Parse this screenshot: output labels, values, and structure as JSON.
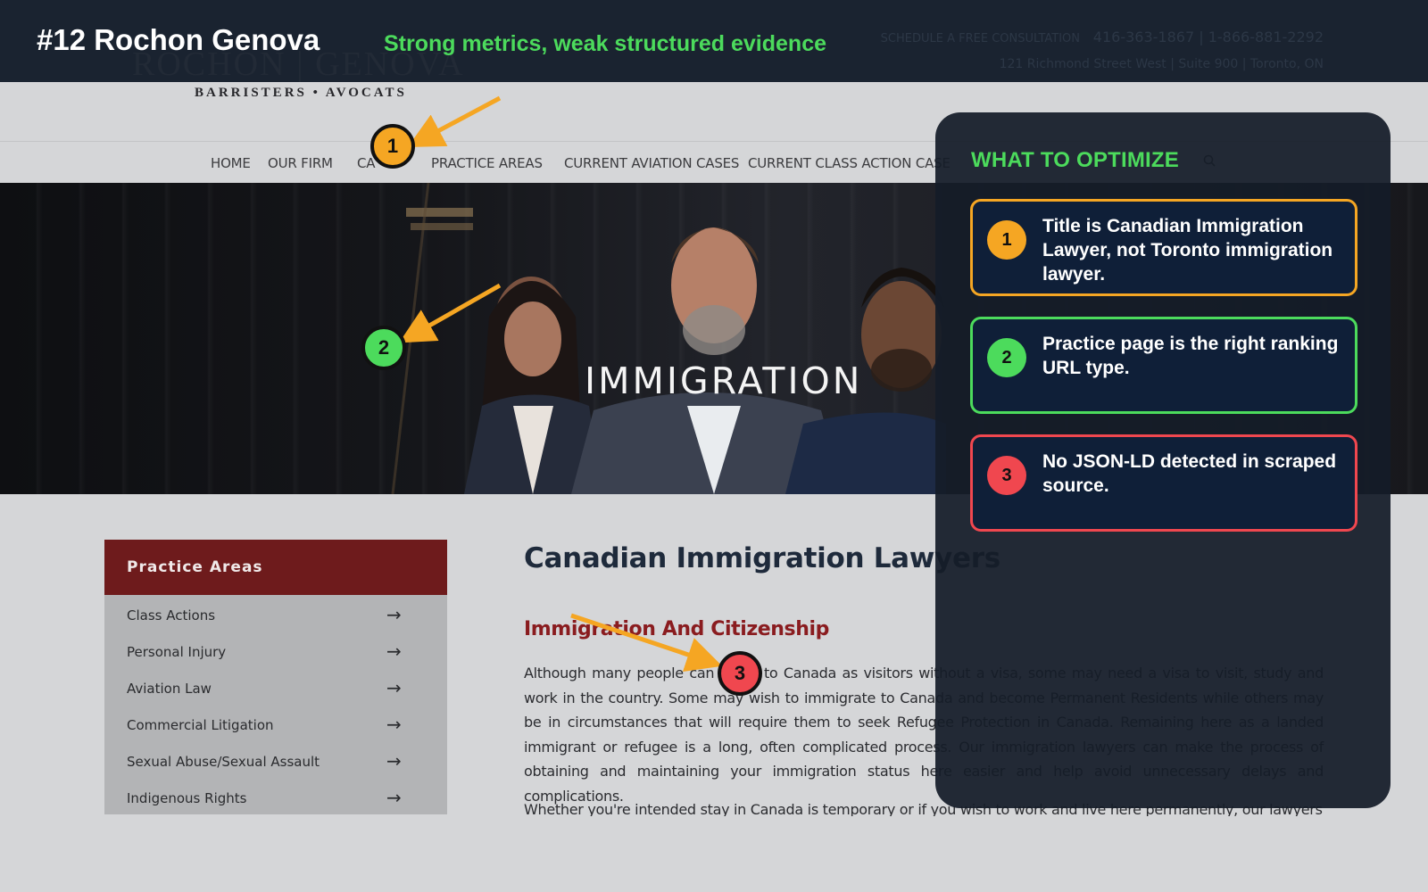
{
  "banner": {
    "title": "#12 Rochon Genova",
    "subtitle": "Strong metrics, weak structured evidence",
    "consult_cta": "SCHEDULE A FREE CONSULTATION",
    "phones": "416-363-1867 | 1-866-881-2292",
    "address": "121 Richmond Street West | Suite 900 | Toronto, ON"
  },
  "logo": {
    "name": "ROCHON | GENOVA",
    "tagline": "BARRISTERS • AVOCATS"
  },
  "nav": {
    "items": [
      "HOME",
      "OUR FIRM",
      "CA",
      "PRACTICE AREAS",
      "CURRENT AVIATION CASES",
      "CURRENT CLASS ACTION CASE"
    ]
  },
  "hero": {
    "title": "IMMIGRATION"
  },
  "sidebar": {
    "heading": "Practice Areas",
    "items": [
      {
        "label": "Class Actions",
        "arrow": "→"
      },
      {
        "label": "Personal Injury",
        "arrow": "→"
      },
      {
        "label": "Aviation Law",
        "arrow": "→"
      },
      {
        "label": "Commercial Litigation",
        "arrow": "→"
      },
      {
        "label": "Sexual Abuse/Sexual Assault",
        "arrow": "→"
      },
      {
        "label": "Indigenous Rights",
        "arrow": "→"
      }
    ]
  },
  "content": {
    "title": "Canadian Immigration Lawyers",
    "subtitle": "Immigration And Citizenship",
    "paragraph1": "Although many people can come to Canada as visitors without a visa, some may need a visa to visit, study and work in the country. Some may wish to immigrate to Canada and become Permanent Residents while others may be in circumstances that will require them to seek Refugee Protection in Canada. Remaining here as a landed immigrant or refugee is a long, often complicated process. Our immigration lawyers can make the process of obtaining and maintaining your immigration status here easier and help avoid unnecessary delays and complications.",
    "paragraph2": "Whether you're intended stay in Canada is temporary or if you wish to work and live here permanently, our lawyers can"
  },
  "panel": {
    "title": "WHAT TO OPTIMIZE",
    "cards": [
      {
        "num": "1",
        "text": "Title is Canadian Immigration Lawyer, not Toronto immigration lawyer.",
        "color": "#f5a623"
      },
      {
        "num": "2",
        "text": "Practice page is the right ranking URL type.",
        "color": "#4cdb5c"
      },
      {
        "num": "3",
        "text": "No JSON-LD detected in scraped source.",
        "color": "#f0474f"
      }
    ]
  },
  "markers": [
    {
      "num": "1",
      "color": "#f5a623"
    },
    {
      "num": "2",
      "color": "#4cdb5c"
    },
    {
      "num": "3",
      "color": "#f0474f"
    }
  ]
}
